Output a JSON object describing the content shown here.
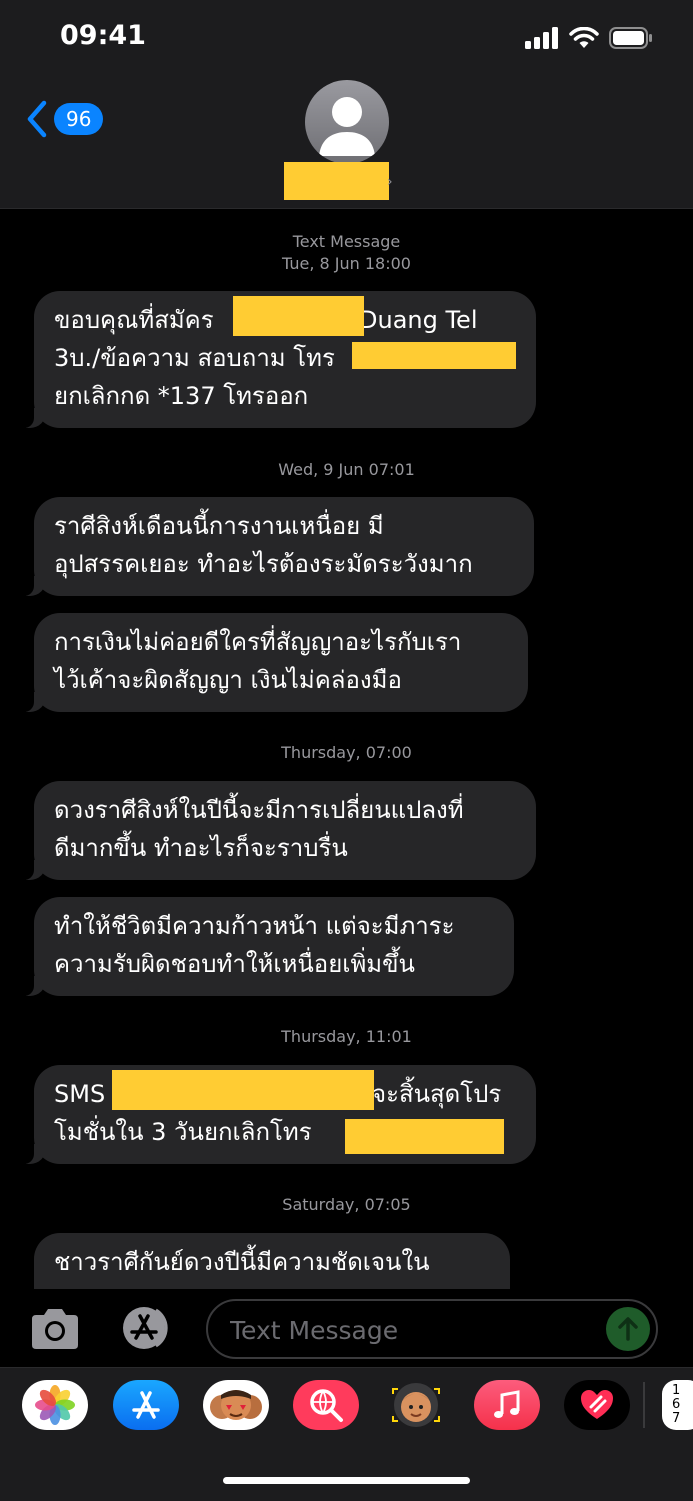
{
  "status_bar": {
    "time": "09:41"
  },
  "nav": {
    "back_count": "96"
  },
  "thread": {
    "groups": [
      {
        "timestamp_label": "Text Message",
        "timestamp_date": "Tue, 8 Jun 18:00"
      },
      {
        "timestamp_date": "Wed, 9 Jun 07:01"
      },
      {
        "timestamp_date": "Thursday, 07:00"
      },
      {
        "timestamp_date": "Thursday, 11:01"
      },
      {
        "timestamp_date": "Saturday, 07:05"
      }
    ],
    "messages": [
      {
        "lines": [
          "ขอบคุณที่สมัคร",
          "Duang Tel",
          "3บ./ข้อความ สอบถาม โทร",
          "ยกเลิกกด *137 โทรออก"
        ]
      },
      {
        "lines": [
          "ราศีสิงห์เดือนนี้การงานเหนื่อย มี",
          "อุปสรรคเยอะ ทำอะไรต้องระมัดระวังมาก"
        ]
      },
      {
        "lines": [
          "การเงินไม่ค่อยดีใครที่สัญญาอะไรกับเรา",
          "ไว้เค้าจะผิดสัญญา เงินไม่คล่องมือ"
        ]
      },
      {
        "lines": [
          "ดวงราศีสิงห์ในปีนี้จะมีการเปลี่ยนแปลงที่",
          "ดีมากขึ้น ทำอะไรก็จะราบรื่น"
        ]
      },
      {
        "lines": [
          "ทำให้ชีวิตมีความก้าวหน้า แต่จะมีภาระ",
          "ความรับผิดชอบทำให้เหนื่อยเพิ่มขึ้น"
        ]
      },
      {
        "lines": [
          "SMS",
          "จะสิ้นสุดโปร",
          "โมชั่นใน 3 วันยกเลิกโทร"
        ]
      },
      {
        "lines": [
          "ชาวราศีกันย์ดวงปีนี้มีความชัดเจนใน"
        ]
      }
    ]
  },
  "composer": {
    "placeholder": "Text Message"
  },
  "app_drawer": {
    "icons": [
      "photos-icon",
      "app-store-icon",
      "memoji-stickers-icon",
      "web-search-icon",
      "memoji-icon",
      "music-icon",
      "digital-touch-icon",
      "sudoku-icon"
    ],
    "partial_icon_text": [
      "1",
      "6",
      "7"
    ]
  },
  "colors": {
    "bubble": "#262628",
    "redaction": "#ffcc33",
    "accent": "#0a84ff",
    "background": "#000000"
  }
}
